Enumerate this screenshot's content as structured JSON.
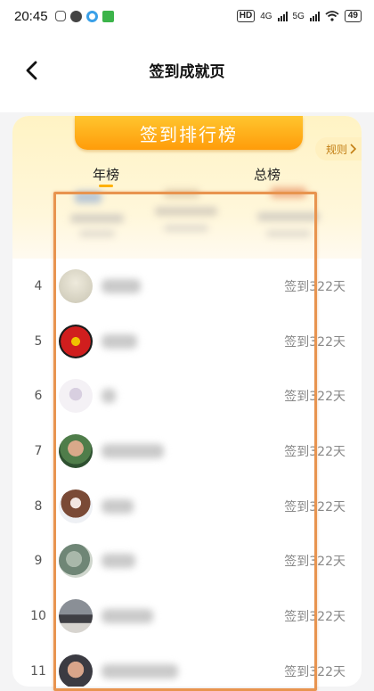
{
  "status_bar": {
    "time": "20:45",
    "network_a": "4G",
    "network_b": "5G",
    "hd_label": "HD",
    "battery": "49"
  },
  "nav": {
    "title": "签到成就页"
  },
  "board": {
    "title": "签到排行榜",
    "rules_label": "规则",
    "tabs": [
      {
        "label": "年榜",
        "active": true
      },
      {
        "label": "总榜",
        "active": false
      }
    ],
    "accent_color": "#ffb100"
  },
  "ranking": [
    {
      "rank": "4",
      "days": "签到322天",
      "avatar": "light-gray-avatar"
    },
    {
      "rank": "5",
      "days": "签到322天",
      "avatar": "red-club-crest-avatar"
    },
    {
      "rank": "6",
      "days": "签到322天",
      "avatar": "person-photo-avatar"
    },
    {
      "rank": "7",
      "days": "签到322天",
      "avatar": "man-glasses-avatar"
    },
    {
      "rank": "8",
      "days": "签到322天",
      "avatar": "girl-bow-avatar"
    },
    {
      "rank": "9",
      "days": "签到322天",
      "avatar": "landscape-avatar"
    },
    {
      "rank": "10",
      "days": "签到322天",
      "avatar": "building-avatar"
    },
    {
      "rank": "11",
      "days": "签到322天",
      "avatar": "man-portrait-avatar"
    }
  ]
}
